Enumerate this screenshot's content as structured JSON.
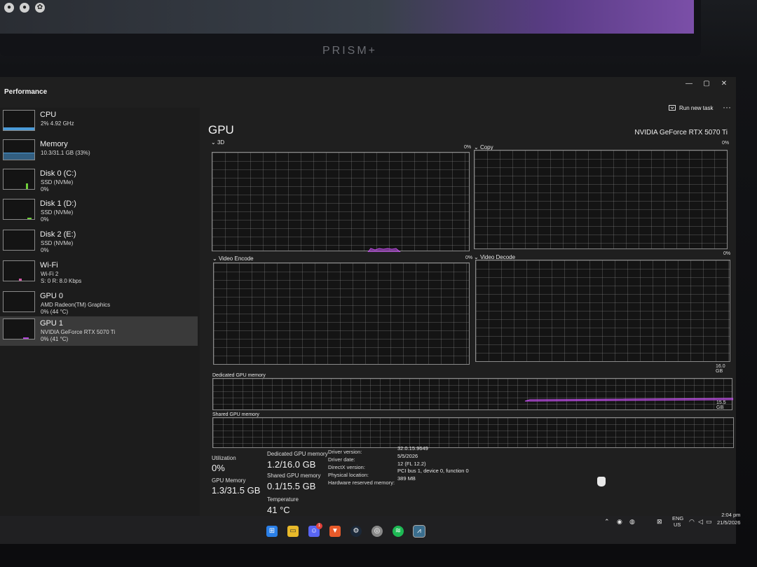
{
  "colors": {
    "accent_purple": "#b044d8",
    "memory_blue": "#4a9bd8",
    "disk_green": "#6fcf3a",
    "wifi_pink": "#d25aa8",
    "grid_line": "#9a9a9a"
  },
  "top_monitor": {
    "brand": "PRISM+"
  },
  "window": {
    "title": "Performance",
    "controls": {
      "minimize": "—",
      "maximize": "▢",
      "close": "✕"
    },
    "toolbar": {
      "run_task_label": "Run new task",
      "run_task_icon": "run-icon",
      "more_label": "···"
    }
  },
  "sidebar": {
    "items": [
      {
        "name": "CPU",
        "sub1": "2% 4.92 GHz",
        "sub2": ""
      },
      {
        "name": "Memory",
        "sub1": "10.3/31.1 GB (33%)",
        "sub2": ""
      },
      {
        "name": "Disk 0 (C:)",
        "sub1": "SSD (NVMe)",
        "sub2": "0%"
      },
      {
        "name": "Disk 1 (D:)",
        "sub1": "SSD (NVMe)",
        "sub2": "0%"
      },
      {
        "name": "Disk 2 (E:)",
        "sub1": "SSD (NVMe)",
        "sub2": "0%"
      },
      {
        "name": "Wi-Fi",
        "sub1": "Wi-Fi 2",
        "sub2": "S: 0 R: 8.0 Kbps"
      },
      {
        "name": "GPU 0",
        "sub1": "AMD Radeon(TM) Graphics",
        "sub2": "0% (44 °C)"
      },
      {
        "name": "GPU 1",
        "sub1": "NVIDIA GeForce RTX 5070 Ti",
        "sub2": "0% (41 °C)"
      }
    ],
    "selected_index": 7
  },
  "gpu": {
    "heading": "GPU",
    "device_name": "NVIDIA GeForce RTX 5070 Ti",
    "engines": [
      {
        "label": "3D",
        "percent": "0%"
      },
      {
        "label": "Copy",
        "percent": "0%"
      },
      {
        "label": "Video Encode",
        "percent": "0%"
      },
      {
        "label": "Video Decode",
        "percent": "0%"
      }
    ],
    "dedicated_graph": {
      "label": "Dedicated GPU memory",
      "max": "16.0 GB"
    },
    "shared_graph": {
      "label": "Shared GPU memory",
      "max": "15.5 GB"
    },
    "stats": {
      "utilization_label": "Utilization",
      "utilization_value": "0%",
      "gpu_memory_label": "GPU Memory",
      "gpu_memory_value": "1.3/31.5 GB",
      "dedicated_label": "Dedicated GPU memory",
      "dedicated_value": "1.2/16.0 GB",
      "shared_label": "Shared GPU memory",
      "shared_value": "0.1/15.5 GB",
      "temperature_label": "Temperature",
      "temperature_value": "41 °C"
    },
    "details": [
      {
        "key": "Driver version:",
        "value": "32.0.15.9649"
      },
      {
        "key": "Driver date:",
        "value": "5/5/2026"
      },
      {
        "key": "DirectX version:",
        "value": "12 (FL 12.2)"
      },
      {
        "key": "Physical location:",
        "value": "PCI bus 1, device 0, function 0"
      },
      {
        "key": "Hardware reserved memory:",
        "value": "389 MB"
      }
    ]
  },
  "taskbar": {
    "apps": [
      "windows-start-icon",
      "file-explorer-icon",
      "discord-icon",
      "brave-icon",
      "steam-icon",
      "chrome-icon",
      "spotify-icon",
      "task-manager-icon"
    ],
    "discord_badge": "1",
    "tray": {
      "lang": "ENG",
      "region": "US",
      "time": "2:04 pm",
      "date": "21/5/2026"
    }
  }
}
